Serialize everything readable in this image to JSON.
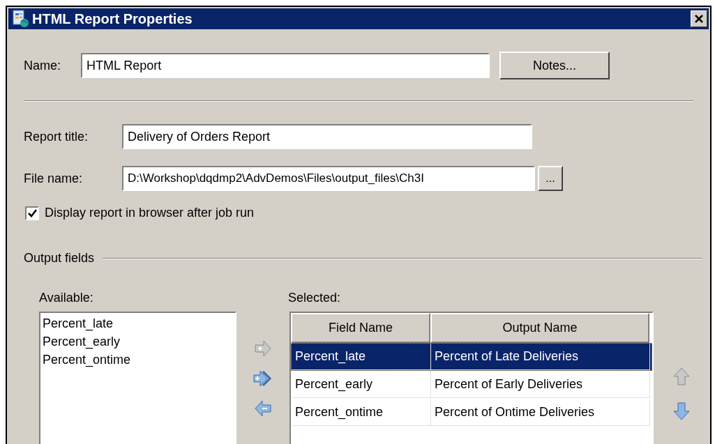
{
  "window": {
    "title": "HTML Report Properties"
  },
  "name_field": {
    "label": "Name:",
    "value": "HTML Report"
  },
  "notes_button": "Notes...",
  "report_title_field": {
    "label": "Report title:",
    "value": "Delivery of Orders Report"
  },
  "file_name_field": {
    "label": "File name:",
    "value": "D:\\Workshop\\dqdmp2\\AdvDemos\\Files\\output_files\\Ch3I",
    "browse": "..."
  },
  "display_checkbox": {
    "label": "Display report in browser after job run",
    "checked": true
  },
  "output_fields": {
    "label": "Output fields",
    "available": {
      "label": "Available:",
      "items": [
        "Percent_late",
        "Percent_early",
        "Percent_ontime"
      ]
    },
    "move_buttons": [
      {
        "kind": "add",
        "disabled": true
      },
      {
        "kind": "add_all",
        "disabled": false
      },
      {
        "kind": "remove",
        "disabled": false
      }
    ],
    "selected": {
      "label": "Selected:",
      "columns": [
        "Field Name",
        "Output Name"
      ],
      "rows": [
        {
          "cells": [
            "Percent_late",
            "Percent of Late Deliveries"
          ],
          "selected": true
        },
        {
          "cells": [
            "Percent_early",
            "Percent of Early Deliveries"
          ],
          "selected": false
        },
        {
          "cells": [
            "Percent_ontime",
            "Percent of Ontime Deliveries"
          ],
          "selected": false
        }
      ]
    },
    "order_buttons": [
      {
        "kind": "up",
        "disabled": true
      },
      {
        "kind": "down",
        "disabled": false
      }
    ]
  }
}
